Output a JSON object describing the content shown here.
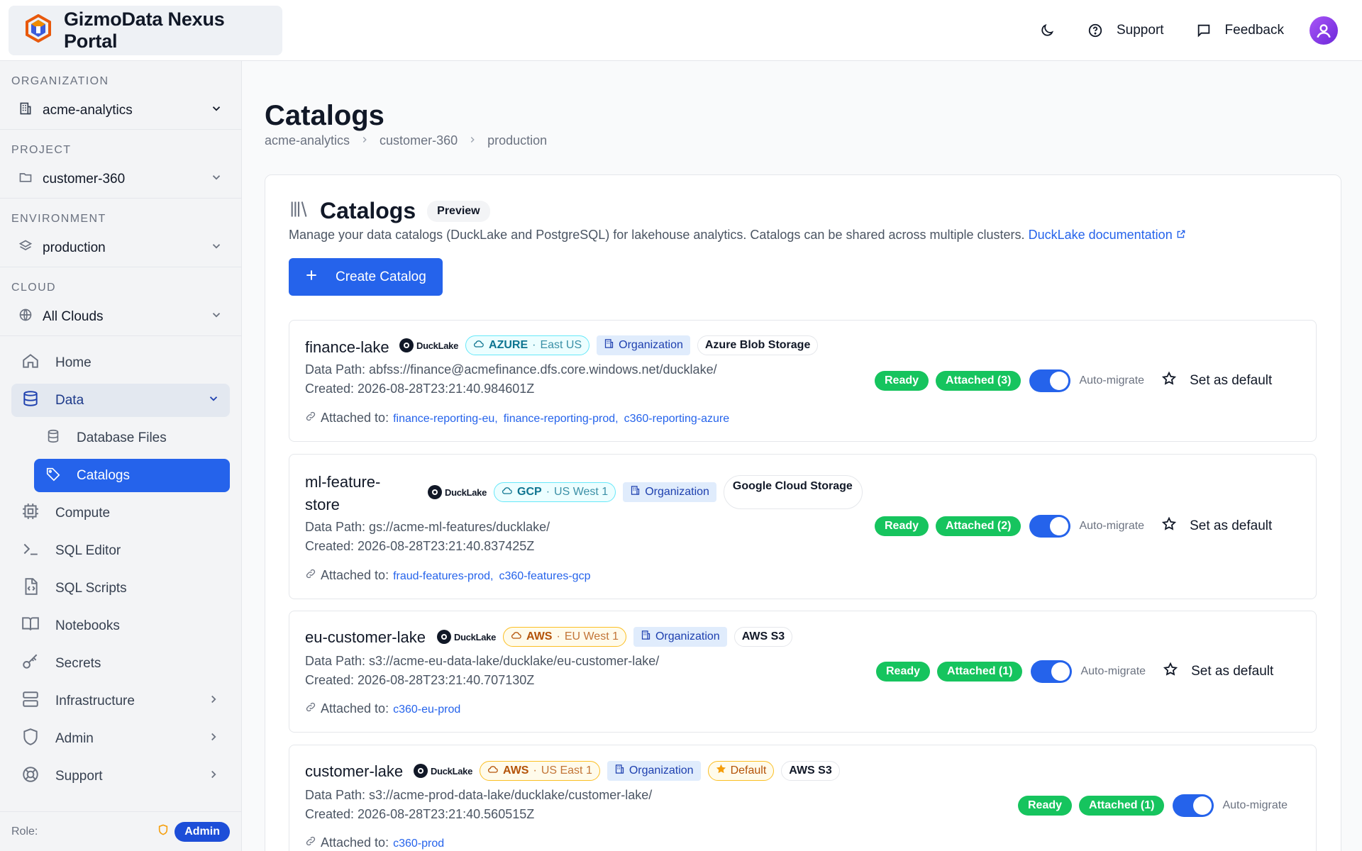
{
  "header": {
    "title": "GizmoData Nexus Portal",
    "support_label": "Support",
    "feedback_label": "Feedback"
  },
  "sidebar": {
    "organization": {
      "label": "ORGANIZATION",
      "value": "acme-analytics"
    },
    "project": {
      "label": "PROJECT",
      "value": "customer-360"
    },
    "environment": {
      "label": "ENVIRONMENT",
      "value": "production"
    },
    "cloud": {
      "label": "CLOUD",
      "value": "All Clouds"
    },
    "nav": {
      "home": "Home",
      "data": "Data",
      "database_files": "Database Files",
      "catalogs": "Catalogs",
      "compute": "Compute",
      "sql_editor": "SQL Editor",
      "sql_scripts": "SQL Scripts",
      "notebooks": "Notebooks",
      "secrets": "Secrets",
      "infrastructure": "Infrastructure",
      "admin": "Admin",
      "support": "Support"
    },
    "role_label": "Role:",
    "role_value": "Admin"
  },
  "main": {
    "page_title": "Catalogs",
    "breadcrumb": [
      "acme-analytics",
      "customer-360",
      "production"
    ],
    "card": {
      "title": "Catalogs",
      "badge": "Preview",
      "description": "Manage your data catalogs (DuckLake and PostgreSQL) for lakehouse analytics. Catalogs can be shared across multiple clusters.",
      "doc_link": "DuckLake documentation",
      "create_button": "Create Catalog"
    },
    "labels": {
      "ducklake": "DuckLake",
      "organization": "Organization",
      "ready": "Ready",
      "auto_migrate": "Auto-migrate",
      "set_default": "Set as default",
      "attached_to": "Attached to:",
      "default": "Default"
    },
    "catalogs": [
      {
        "name": "finance-lake",
        "cloud": "AZURE",
        "region": "East US",
        "storage": "Azure Blob Storage",
        "data_path": "Data Path: abfss://finance@acmefinance.dfs.core.windows.net/ducklake/",
        "created": "Created: 2026-08-28T23:21:40.984601Z",
        "attached_count": "Attached (3)",
        "attached": [
          "finance-reporting-eu",
          "finance-reporting-prod",
          "c360-reporting-azure"
        ]
      },
      {
        "name": "ml-feature-store",
        "cloud": "GCP",
        "region": "US West 1",
        "storage": "Google Cloud Storage",
        "data_path": "Data Path: gs://acme-ml-features/ducklake/",
        "created": "Created: 2026-08-28T23:21:40.837425Z",
        "attached_count": "Attached (2)",
        "attached": [
          "fraud-features-prod",
          "c360-features-gcp"
        ]
      },
      {
        "name": "eu-customer-lake",
        "cloud": "AWS",
        "region": "EU West 1",
        "storage": "AWS S3",
        "data_path": "Data Path: s3://acme-eu-data-lake/ducklake/eu-customer-lake/",
        "created": "Created: 2026-08-28T23:21:40.707130Z",
        "attached_count": "Attached (1)",
        "attached": [
          "c360-eu-prod"
        ]
      },
      {
        "name": "customer-lake",
        "cloud": "AWS",
        "region": "US East 1",
        "storage": "AWS S3",
        "data_path": "Data Path: s3://acme-prod-data-lake/ducklake/customer-lake/",
        "created": "Created: 2026-08-28T23:21:40.560515Z",
        "attached_count": "Attached (1)",
        "attached": [
          "c360-prod"
        ]
      }
    ]
  }
}
